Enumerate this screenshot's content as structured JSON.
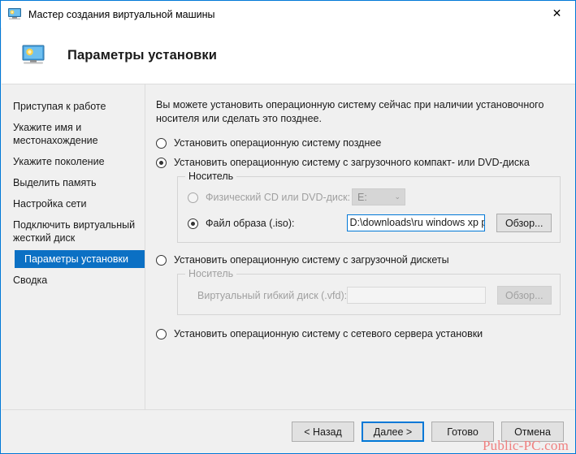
{
  "window": {
    "title": "Мастер создания виртуальной машины",
    "close_label": "✕",
    "icon": "monitor-icon",
    "accent_color": "#0078d7",
    "body_bg": "#f0f0f0"
  },
  "header": {
    "title": "Параметры установки",
    "icon": "monitor-icon"
  },
  "sidebar": {
    "items": [
      {
        "label": "Приступая к работе",
        "selected": false
      },
      {
        "label": "Укажите имя и местонахождение",
        "selected": false
      },
      {
        "label": "Укажите поколение",
        "selected": false
      },
      {
        "label": "Выделить память",
        "selected": false
      },
      {
        "label": "Настройка сети",
        "selected": false
      },
      {
        "label": "Подключить виртуальный жесткий диск",
        "selected": false
      },
      {
        "label": "Параметры установки",
        "selected": true
      },
      {
        "label": "Сводка",
        "selected": false
      }
    ],
    "selected_bg": "#0b70c4"
  },
  "main": {
    "intro": "Вы можете установить операционную систему сейчас при наличии установочного носителя или сделать это позднее.",
    "option_later": {
      "label": "Установить операционную систему позднее",
      "checked": false
    },
    "option_cd": {
      "label": "Установить операционную систему с загрузочного компакт- или DVD-диска",
      "checked": true
    },
    "cd_group": {
      "title": "Носитель",
      "physical": {
        "label": "Физический CD или DVD-диск:",
        "checked": false,
        "drive_value": "E:",
        "chevron": "⌄"
      },
      "image": {
        "label": "Файл образа (.iso):",
        "checked": true,
        "path_value": "D:\\downloads\\ru windows xp professional",
        "browse_label": "Обзор..."
      }
    },
    "option_floppy": {
      "label": "Установить операционную систему с загрузочной дискеты",
      "checked": false
    },
    "floppy_group": {
      "title": "Носитель",
      "vfd_label": "Виртуальный гибкий диск (.vfd):",
      "vfd_value": "",
      "browse_label": "Обзор..."
    },
    "option_network": {
      "label": "Установить операционную систему с сетевого сервера установки",
      "checked": false
    }
  },
  "footer": {
    "back_label": "< Назад",
    "next_label": "Далее >",
    "finish_label": "Готово",
    "cancel_label": "Отмена",
    "watermark": "Public-PC.com",
    "watermark_color": "#f08080"
  }
}
